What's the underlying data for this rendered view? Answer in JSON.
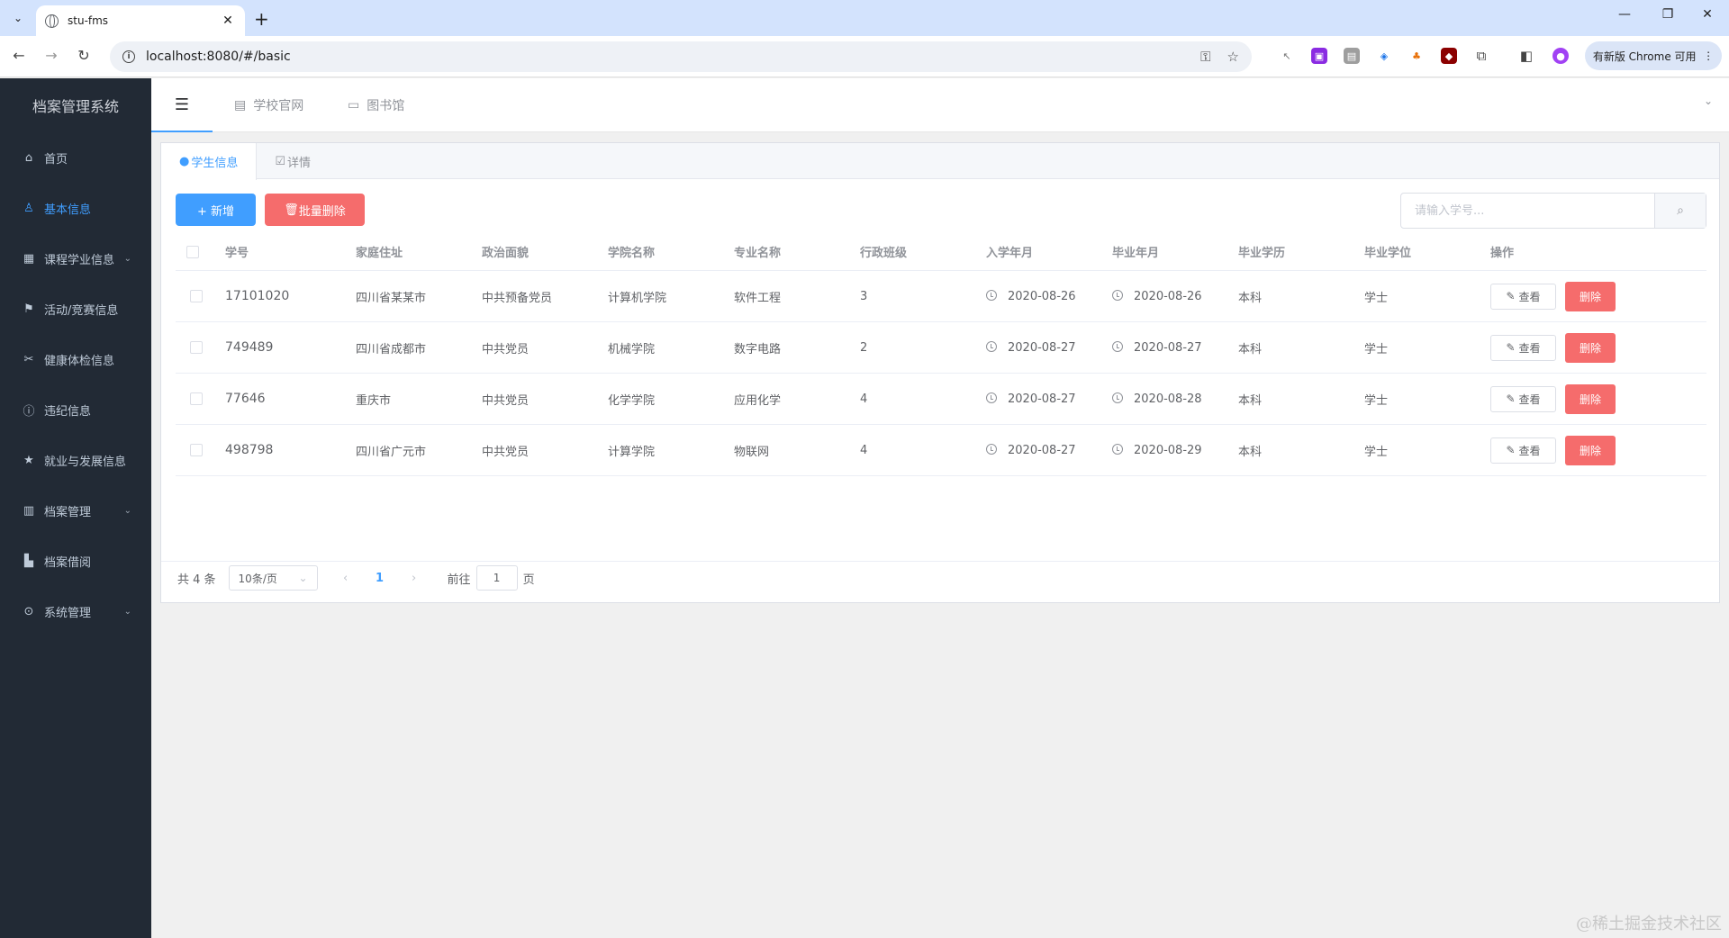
{
  "browser": {
    "tab_title": "stu-fms",
    "url": "localhost:8080/#/basic",
    "update_label": "有新版 Chrome 可用"
  },
  "sidebar": {
    "logo": "档案管理系统",
    "items": [
      {
        "label": "首页",
        "icon": "home-icon"
      },
      {
        "label": "基本信息",
        "icon": "user-icon",
        "active": true
      },
      {
        "label": "课程学业信息",
        "icon": "grid-icon",
        "submenu": true
      },
      {
        "label": "活动/竞赛信息",
        "icon": "flag-icon"
      },
      {
        "label": "健康体检信息",
        "icon": "scissors-icon"
      },
      {
        "label": "违纪信息",
        "icon": "info-icon"
      },
      {
        "label": "就业与发展信息",
        "icon": "star-icon"
      },
      {
        "label": "档案管理",
        "icon": "chart-icon",
        "submenu": true
      },
      {
        "label": "档案借阅",
        "icon": "stamp-icon"
      },
      {
        "label": "系统管理",
        "icon": "location-icon",
        "submenu": true
      }
    ]
  },
  "header": {
    "nav": [
      {
        "label": "学校官网",
        "icon": "building-icon"
      },
      {
        "label": "图书馆",
        "icon": "library-icon"
      }
    ]
  },
  "content": {
    "tabs": [
      {
        "label": "学生信息",
        "icon": "info-icon",
        "active": true
      },
      {
        "label": "详情",
        "icon": "edit-icon"
      }
    ],
    "add_label": "+ 新增",
    "bulk_delete_label": "批量删除",
    "search_placeholder": "请输入学号...",
    "table": {
      "columns": [
        "学号",
        "家庭住址",
        "政治面貌",
        "学院名称",
        "专业名称",
        "行政班级",
        "入学年月",
        "毕业年月",
        "毕业学历",
        "毕业学位",
        "操作"
      ],
      "rows": [
        {
          "id": "17101020",
          "address": "四川省某某市",
          "political": "中共预备党员",
          "college": "计算机学院",
          "major": "软件工程",
          "class": "3",
          "enroll": "2020-08-26",
          "graduate": "2020-08-26",
          "education": "本科",
          "degree": "学士"
        },
        {
          "id": "749489",
          "address": "四川省成都市",
          "political": "中共党员",
          "college": "机械学院",
          "major": "数字电路",
          "class": "2",
          "enroll": "2020-08-27",
          "graduate": "2020-08-27",
          "education": "本科",
          "degree": "学士"
        },
        {
          "id": "77646",
          "address": "重庆市",
          "political": "中共党员",
          "college": "化学学院",
          "major": "应用化学",
          "class": "4",
          "enroll": "2020-08-27",
          "graduate": "2020-08-28",
          "education": "本科",
          "degree": "学士"
        },
        {
          "id": "498798",
          "address": "四川省广元市",
          "political": "中共党员",
          "college": "计算学院",
          "major": "物联网",
          "class": "4",
          "enroll": "2020-08-27",
          "graduate": "2020-08-29",
          "education": "本科",
          "degree": "学士"
        }
      ],
      "view_label": "查看",
      "delete_label": "删除"
    },
    "pagination": {
      "total": "共 4 条",
      "page_size": "10条/页",
      "current_page": "1",
      "goto_prefix": "前往",
      "goto_value": "1",
      "goto_suffix": "页"
    }
  },
  "watermark": "@稀土掘金技术社区"
}
